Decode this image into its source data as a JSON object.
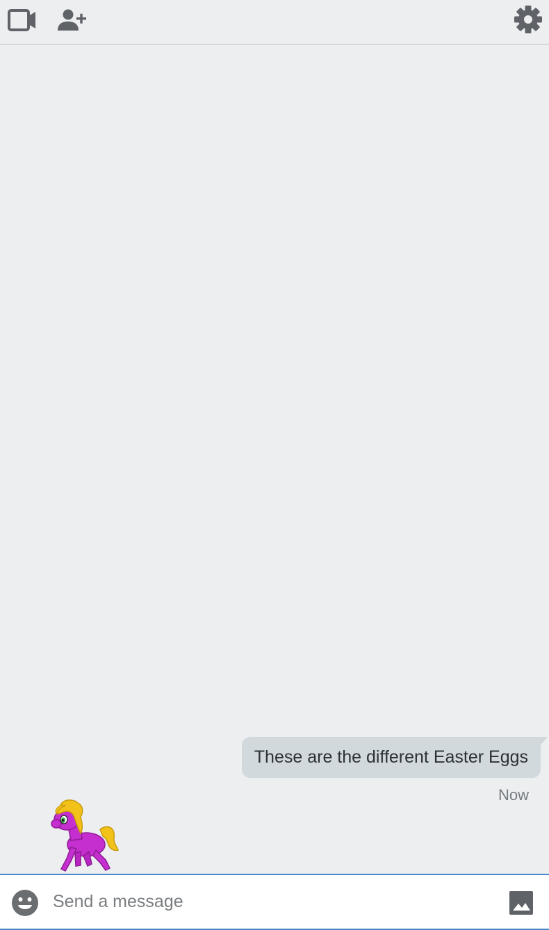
{
  "toolbar": {
    "video_icon": "video-camera-icon",
    "add_person_icon": "person-add-icon",
    "settings_icon": "gear-icon"
  },
  "messages": [
    {
      "text": "These are the different Easter Eggs",
      "time": "Now",
      "outgoing": true
    }
  ],
  "composer": {
    "placeholder": "Send a message",
    "emoji_icon": "emoji-smile-icon",
    "image_icon": "image-icon"
  },
  "colors": {
    "background": "#eceef0",
    "bubble": "#d1d9dc",
    "accent": "#4a86c8",
    "icon": "#5f6368"
  }
}
